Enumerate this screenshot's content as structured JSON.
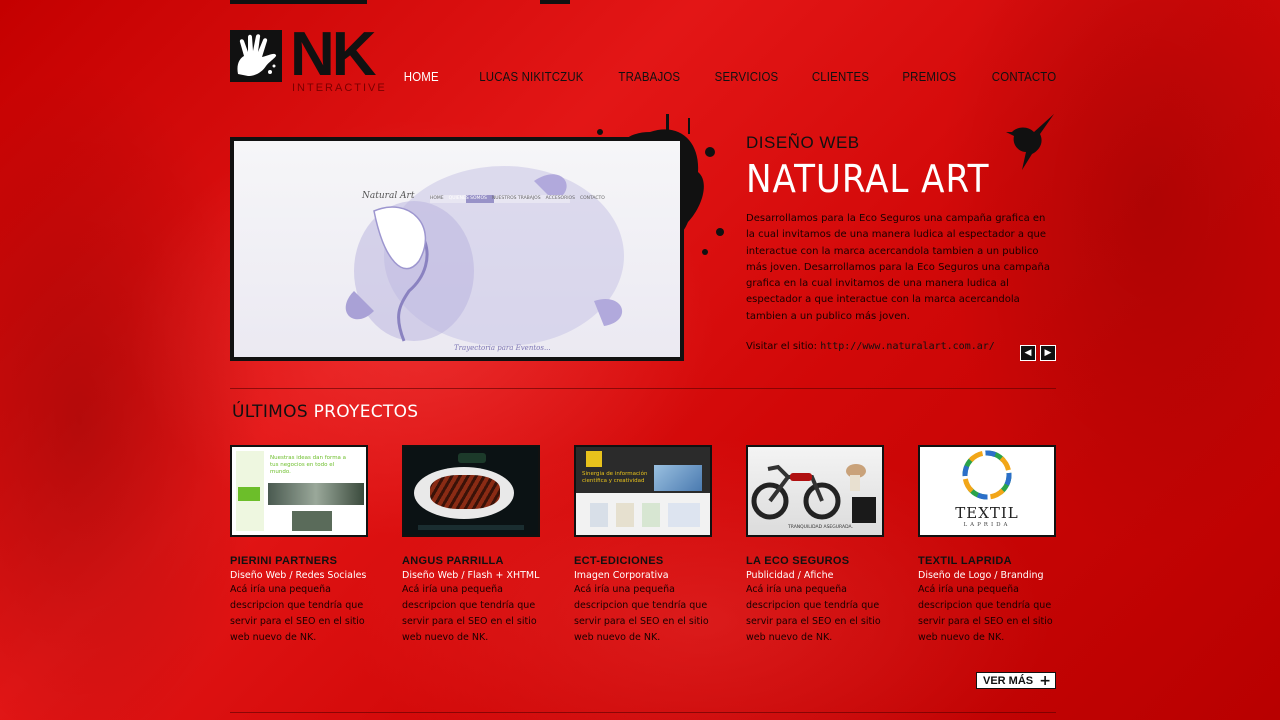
{
  "brand": {
    "logo_text": "NK",
    "logo_sub": "INTERACTIVE"
  },
  "nav": {
    "items": [
      {
        "label": "HOME",
        "active": true
      },
      {
        "label": "LUCAS NIKITCZUK"
      },
      {
        "label": "TRABAJOS"
      },
      {
        "label": "SERVICIOS"
      },
      {
        "label": "CLIENTES"
      },
      {
        "label": "PREMIOS"
      },
      {
        "label": "CONTACTO"
      }
    ]
  },
  "featured": {
    "category": "DISEÑO WEB",
    "title": "NATURAL ART",
    "description": "Desarrollamos para la Eco Seguros una campaña grafica en la cual invitamos de una manera ludica al espectador a que interactue con la marca acercandola tambien a un publico más joven. Desarrollamos para la Eco Seguros una campaña grafica en la cual invitamos de una manera ludica al espectador a que interactue con la marca acercandola tambien a un publico más joven.",
    "visit_label": "Visitar el sitio:",
    "visit_url": "http://www.naturalart.com.ar/",
    "prev": "◀",
    "next": "▶",
    "preview": {
      "site_name": "Natural Art",
      "menu": [
        "HOME",
        "QUIENES SOMOS",
        "NUESTROS TRABAJOS",
        "ACCESORIOS",
        "CONTACTO"
      ],
      "footer": "Trayectoria para Eventos..."
    }
  },
  "section": {
    "title_a": "ÚLTIMOS",
    "title_b": " PROYECTOS"
  },
  "projects": [
    {
      "name": "PIERINI PARTNERS",
      "category": "Diseño Web / Redes Sociales",
      "description": "Acá iría una pequeña descripcion que tendría que servir para el SEO en el sitio web nuevo de NK."
    },
    {
      "name": "ANGUS PARRILLA",
      "category": "Diseño Web / Flash + XHTML",
      "description": "Acá iría una pequeña descripcion que tendría que servir para el SEO en el sitio web nuevo de NK."
    },
    {
      "name": "ECT-EDICIONES",
      "category": "Imagen Corporativa",
      "description": "Acá iría una pequeña descripcion que tendría que servir para el SEO en el sitio web nuevo de NK."
    },
    {
      "name": "LA ECO SEGUROS",
      "category": "Publicidad / Afiche",
      "description": "Acá iría una pequeña descripcion que tendría que servir para el SEO en el sitio web nuevo de NK."
    },
    {
      "name": "TEXTIL LAPRIDA",
      "category": "Diseño de Logo / Branding",
      "description": "Acá iría una pequeña descripcion que tendría que servir para el SEO en el sitio web nuevo de NK."
    }
  ],
  "thumb_texts": {
    "pierini": "Nuestras ideas dan forma a tus negocios en todo el mundo.",
    "ect": "Sinergia de información científica y creatividad",
    "eco": "TRANQUILIDAD ASEGURADA.",
    "textil_main": "TEXTIL",
    "textil_sub": "LAPRIDA"
  },
  "more_button": {
    "label": "VER MÁS",
    "icon": "plus-icon"
  },
  "colors": {
    "background": "#d60d0d",
    "accent_text": "#ffffff",
    "dark": "#111111"
  }
}
